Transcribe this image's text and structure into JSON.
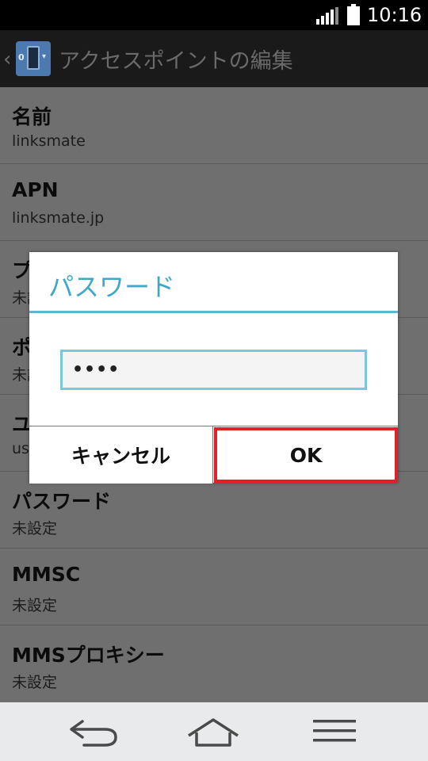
{
  "status_bar": {
    "time": "10:16",
    "signal_icon": "signal-bars-icon",
    "battery_icon": "battery-full-icon"
  },
  "action_bar": {
    "title": "アクセスポイントの編集",
    "back_icon": "chevron-left-icon",
    "app_icon_left": "0",
    "app_icon_right": "▾"
  },
  "settings": {
    "items": [
      {
        "title": "名前",
        "value": "linksmate"
      },
      {
        "title": "APN",
        "value": "linksmate.jp"
      },
      {
        "title": "プロキシ",
        "value": "未設定"
      },
      {
        "title": "ポート",
        "value": "未設定"
      },
      {
        "title": "ユーザー名",
        "value": "user"
      },
      {
        "title": "パスワード",
        "value": "未設定"
      },
      {
        "title": "MMSC",
        "value": "未設定"
      },
      {
        "title": "MMSプロキシー",
        "value": "未設定"
      }
    ]
  },
  "dialog": {
    "title": "パスワード",
    "password_value": "••••",
    "cancel_label": "キャンセル",
    "ok_label": "OK",
    "highlight_color": "#e0202a",
    "accent_color": "#3fa8c6"
  },
  "nav_bar": {
    "back_icon": "back-arrow-icon",
    "home_icon": "home-icon",
    "menu_icon": "menu-icon"
  }
}
